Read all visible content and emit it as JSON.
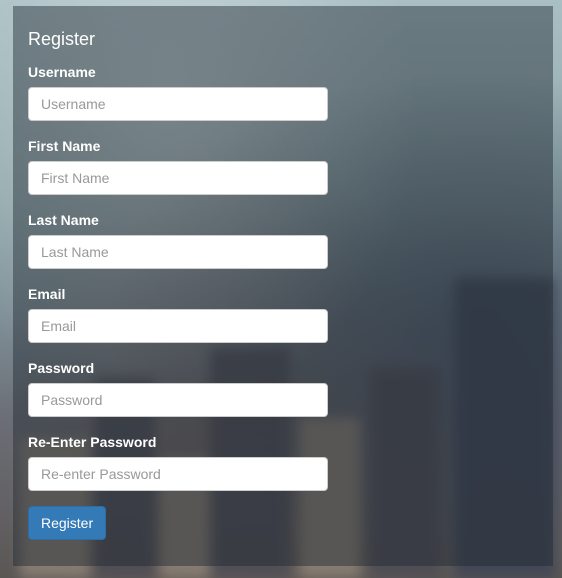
{
  "form": {
    "title": "Register",
    "fields": [
      {
        "label": "Username",
        "placeholder": "Username",
        "value": ""
      },
      {
        "label": "First Name",
        "placeholder": "First Name",
        "value": ""
      },
      {
        "label": "Last Name",
        "placeholder": "Last Name",
        "value": ""
      },
      {
        "label": "Email",
        "placeholder": "Email",
        "value": ""
      },
      {
        "label": "Password",
        "placeholder": "Password",
        "value": ""
      },
      {
        "label": "Re-Enter Password",
        "placeholder": "Re-enter Password",
        "value": ""
      }
    ],
    "submit_label": "Register"
  },
  "colors": {
    "button": "#337ab7",
    "panel_overlay": "rgba(30,40,48,0.45)"
  }
}
